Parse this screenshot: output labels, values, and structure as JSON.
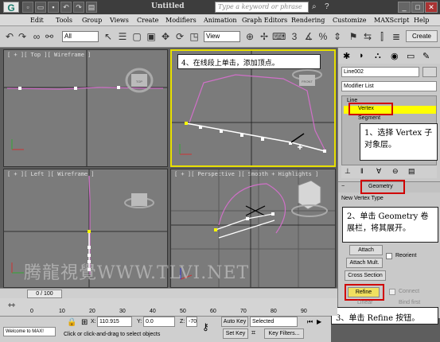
{
  "titlebar": {
    "logo": "G",
    "title": "Untitled",
    "search_placeholder": "Type a keyword or phrase",
    "help": "?",
    "minimize": "_",
    "maximize": "□",
    "close": "✕"
  },
  "menu": [
    "Edit",
    "Tools",
    "Group",
    "Views",
    "Create",
    "Modifiers",
    "Animation",
    "Graph Editors",
    "Rendering",
    "Customize",
    "MAXScript",
    "Help"
  ],
  "toolbar": {
    "selection_filter": "All",
    "ref_coord": "View",
    "create_label": "Create"
  },
  "viewports": {
    "top": "[ + ][ Top ][ Wireframe ]",
    "front": "",
    "left": "[ + ][ Left ][ Wireframe ]",
    "perspective": "[ + ][ Perspective ][ Smooth + Highlights ]",
    "viewcube_top": "TOP",
    "viewcube_front": "FRONT"
  },
  "panel": {
    "object_name": "Line002",
    "modifier_list": "Modifier List",
    "stack": [
      "Line",
      "Vertex",
      "Segment"
    ],
    "rollout_title": "Geometry",
    "new_vertex_type": "New Vertex Type",
    "buttons": {
      "attach": "Attach",
      "attach_mult": "Attach Mult.",
      "cross_section": "Cross Section",
      "refine": "Refine",
      "linear": "Linear"
    },
    "checks": {
      "reorient": "Reorient",
      "connect": "Connect",
      "bind_first": "Bind first"
    }
  },
  "callouts": {
    "c1": "4、在线段上单击，添加顶点。",
    "c2": "1、选择 Vertex 子对象层。",
    "c3": "2、单击 Geometry 卷展栏，将其展开。",
    "c4": "3、单击 Refine 按钮。"
  },
  "timeline": {
    "frame": "0 / 100",
    "ticks": [
      "0",
      "10",
      "20",
      "30",
      "40",
      "50",
      "60",
      "70",
      "80",
      "90"
    ]
  },
  "status": {
    "welcome": "Welcome to MAX!",
    "prompt": "Click or click-and-drag to select objects",
    "x_label": "X:",
    "x_value": "110.915",
    "y_label": "Y:",
    "y_value": "0.0",
    "z_label": "Z:",
    "z_value": "-70",
    "auto_key": "Auto Key",
    "selected": "Selected",
    "set_key": "Set Key",
    "key_filters": "Key Filters..."
  },
  "watermark": "腾龍視覺WWW.TLVI.NET"
}
